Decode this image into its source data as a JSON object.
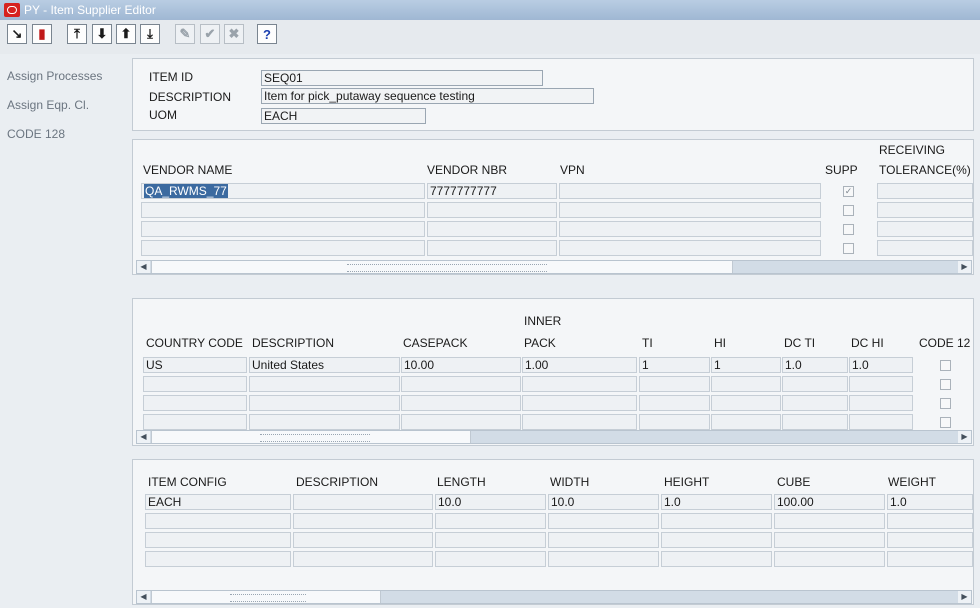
{
  "window": {
    "title": "PY - Item Supplier Editor"
  },
  "toolbar": {
    "buttons": [
      {
        "name": "select-icon",
        "glyph": "↘"
      },
      {
        "name": "exit-icon",
        "glyph": "▮"
      },
      {
        "name": "first-record-icon",
        "glyph": "⤒"
      },
      {
        "name": "next-record-icon",
        "glyph": "⬇"
      },
      {
        "name": "previous-record-icon",
        "glyph": "⬆"
      },
      {
        "name": "last-record-icon",
        "glyph": "⤓"
      },
      {
        "name": "edit-icon",
        "glyph": "✎"
      },
      {
        "name": "ok-icon",
        "glyph": "✔"
      },
      {
        "name": "cancel-icon",
        "glyph": "✖"
      },
      {
        "name": "help-icon",
        "glyph": "?"
      }
    ]
  },
  "sidebar": {
    "items": [
      "Assign Processes",
      "Assign Eqp. Cl.",
      "CODE 128"
    ]
  },
  "header": {
    "item_id_label": "ITEM ID",
    "item_id_value": "SEQ01",
    "description_label": "DESCRIPTION",
    "description_value": "Item for pick_putaway sequence testing",
    "uom_label": "UOM",
    "uom_value": "EACH"
  },
  "vendors": {
    "columns": [
      "VENDOR NAME",
      "VENDOR NBR",
      "VPN",
      "SUPP",
      "RECEIVING",
      "TOLERANCE(%)"
    ],
    "rows": [
      {
        "name": "QA_RWMS_77",
        "nbr": "7777777777",
        "vpn": "",
        "supp": true,
        "tolerance": ""
      },
      {
        "name": "",
        "nbr": "",
        "vpn": "",
        "supp": false,
        "tolerance": ""
      },
      {
        "name": "",
        "nbr": "",
        "vpn": "",
        "supp": false,
        "tolerance": ""
      },
      {
        "name": "",
        "nbr": "",
        "vpn": "",
        "supp": false,
        "tolerance": ""
      }
    ]
  },
  "countries": {
    "columns": [
      "COUNTRY CODE",
      "DESCRIPTION",
      "CASEPACK",
      "INNER",
      "PACK",
      "TI",
      "HI",
      "DC TI",
      "DC HI",
      "CODE 12"
    ],
    "rows": [
      {
        "code": "US",
        "desc": "United States",
        "casepack": "10.00",
        "inner": "1.00",
        "ti": "1",
        "hi": "1",
        "dcti": "1.0",
        "dchi": "1.0",
        "code128": false
      },
      {
        "code": "",
        "desc": "",
        "casepack": "",
        "inner": "",
        "ti": "",
        "hi": "",
        "dcti": "",
        "dchi": "",
        "code128": false
      },
      {
        "code": "",
        "desc": "",
        "casepack": "",
        "inner": "",
        "ti": "",
        "hi": "",
        "dcti": "",
        "dchi": "",
        "code128": false
      },
      {
        "code": "",
        "desc": "",
        "casepack": "",
        "inner": "",
        "ti": "",
        "hi": "",
        "dcti": "",
        "dchi": "",
        "code128": false
      }
    ]
  },
  "configs": {
    "columns": [
      "ITEM CONFIG",
      "DESCRIPTION",
      "LENGTH",
      "WIDTH",
      "HEIGHT",
      "CUBE",
      "WEIGHT"
    ],
    "rows": [
      {
        "config": "EACH",
        "desc": "",
        "length": "10.0",
        "width": "10.0",
        "height": "1.0",
        "cube": "100.00",
        "weight": "1.0"
      },
      {
        "config": "",
        "desc": "",
        "length": "",
        "width": "",
        "height": "",
        "cube": "",
        "weight": ""
      },
      {
        "config": "",
        "desc": "",
        "length": "",
        "width": "",
        "height": "",
        "cube": "",
        "weight": ""
      },
      {
        "config": "",
        "desc": "",
        "length": "",
        "width": "",
        "height": "",
        "cube": "",
        "weight": ""
      }
    ]
  },
  "scroll": {
    "left_arrow": "◀",
    "right_arrow": "▶"
  }
}
